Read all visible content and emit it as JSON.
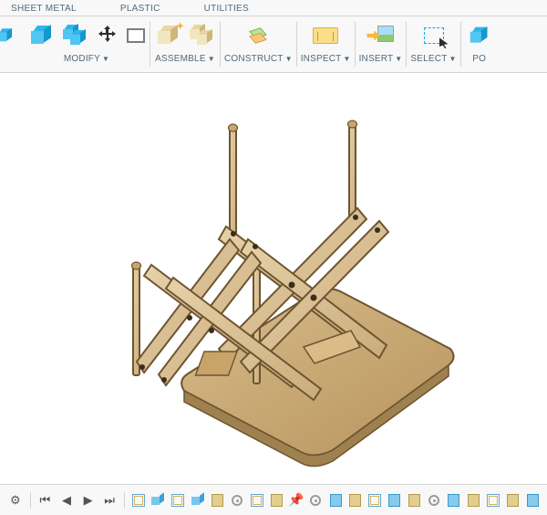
{
  "tabs": {
    "sheet_metal": "SHEET METAL",
    "plastic": "PLASTIC",
    "utilities": "UTILITIES"
  },
  "ribbon": {
    "modify": "MODIFY",
    "assemble": "ASSEMBLE",
    "construct": "CONSTRUCT",
    "inspect": "INSPECT",
    "insert": "INSERT",
    "select": "SELECT",
    "cutoff": "PO"
  },
  "timeline": {
    "play": "▶",
    "end": "⏭",
    "start": "⏮",
    "back": "◀",
    "gear": "⚙"
  }
}
